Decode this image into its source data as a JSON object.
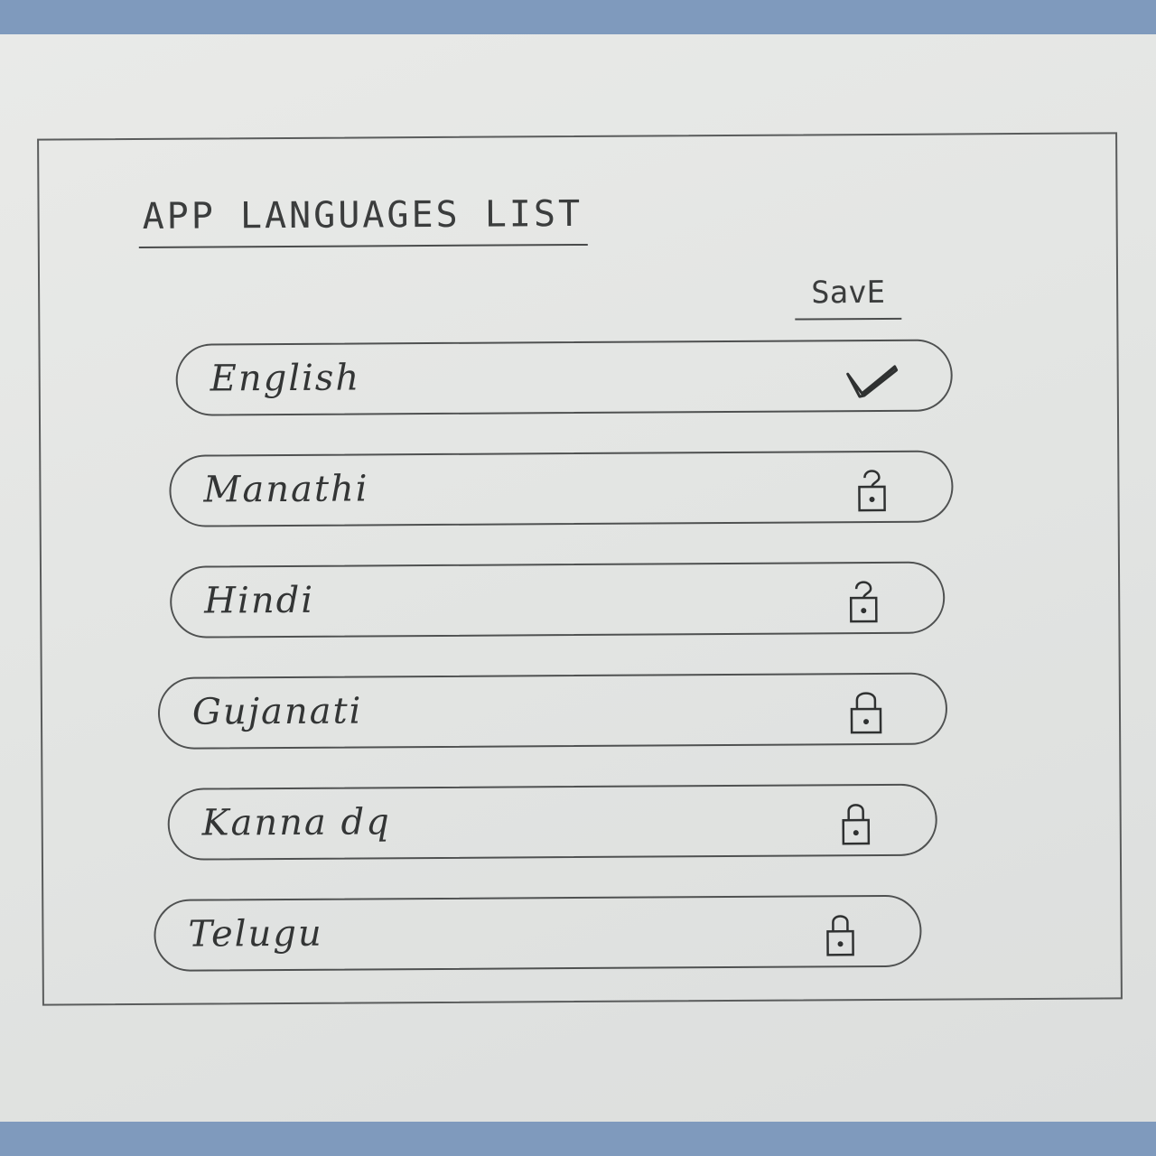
{
  "header": {
    "title": "APP LANGUAGES LIST",
    "save_label": "SavE"
  },
  "languages": [
    {
      "label": "English",
      "status": "selected",
      "icon": "checkmark-icon"
    },
    {
      "label": "Manathi",
      "status": "unlocked",
      "icon": "unlocked-lock-icon"
    },
    {
      "label": "Hindi",
      "status": "unlocked",
      "icon": "unlocked-lock-icon"
    },
    {
      "label": "Gujanati",
      "status": "locked",
      "icon": "lock-icon"
    },
    {
      "label": "Kanna dq",
      "status": "locked",
      "icon": "lock-icon"
    },
    {
      "label": "Telugu",
      "status": "locked",
      "icon": "lock-icon"
    }
  ],
  "colors": {
    "background": "#7f9abd",
    "paper": "#e5e7e5",
    "pencil": "#3b3d3d"
  }
}
